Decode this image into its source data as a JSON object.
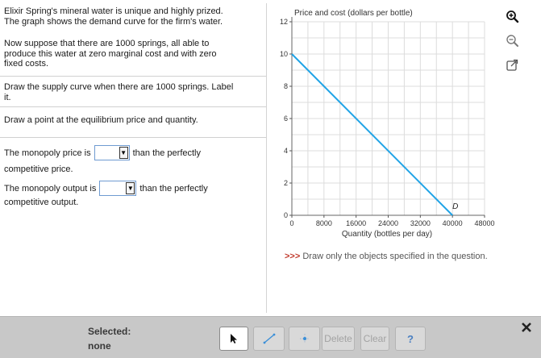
{
  "question": {
    "intro_line1": "Elixir Spring's mineral water is unique and highly prized.",
    "intro_line2": "The graph shows the demand curve for the firm's water.",
    "suppose_line1": "Now suppose that there are 1000 springs, all able to",
    "suppose_line2": "produce this water at zero marginal cost and with zero",
    "suppose_line3": "fixed costs.",
    "task1_line1": "Draw the supply curve when there are 1000 springs. Label",
    "task1_line2": "it.",
    "task2": "Draw a point at the equilibrium price and quantity.",
    "q1_before": "The monopoly price is",
    "q1_after": "than the perfectly",
    "q1_line2": "competitive price.",
    "q1_selected": "",
    "q2_before": "The monopoly output is",
    "q2_after": "than the perfectly",
    "q2_line2": "competitive output.",
    "q2_selected": ""
  },
  "chart_data": {
    "type": "line",
    "title": "Price and cost (dollars per bottle)",
    "xlabel": "Quantity (bottles per day)",
    "ylabel": "",
    "xlim": [
      0,
      48000
    ],
    "ylim": [
      0,
      12
    ],
    "x_ticks": [
      0,
      8000,
      16000,
      24000,
      32000,
      40000,
      48000
    ],
    "y_ticks": [
      0,
      2,
      4,
      6,
      8,
      10,
      12
    ],
    "x_tick_labels": [
      "0",
      "8000",
      "16000",
      "24000",
      "32000",
      "40000",
      "48000"
    ],
    "y_tick_labels": [
      "0",
      "2",
      "4",
      "6",
      "8",
      "10",
      "12"
    ],
    "grid": true,
    "series": [
      {
        "name": "",
        "label": "D",
        "color": "#1fa3e6",
        "x": [
          0,
          40000
        ],
        "y": [
          10,
          0
        ]
      }
    ]
  },
  "graph_tools": {
    "zoom_in_icon": "zoom-in-icon",
    "zoom_out_icon": "zoom-out-icon",
    "popout_icon": "external-link-icon"
  },
  "note": {
    "prefix": ">>>",
    "text": "Draw only the objects specified in the question."
  },
  "toolbar": {
    "selected_label": "Selected:",
    "selected_value": "none",
    "delete_label": "Delete",
    "clear_label": "Clear",
    "help_label": "?"
  },
  "colors": {
    "demand_line": "#1fa3e6",
    "grid": "#dcdcdc",
    "toolbar_bg": "#c8c8c8",
    "help_blue": "#4a7fc1"
  }
}
